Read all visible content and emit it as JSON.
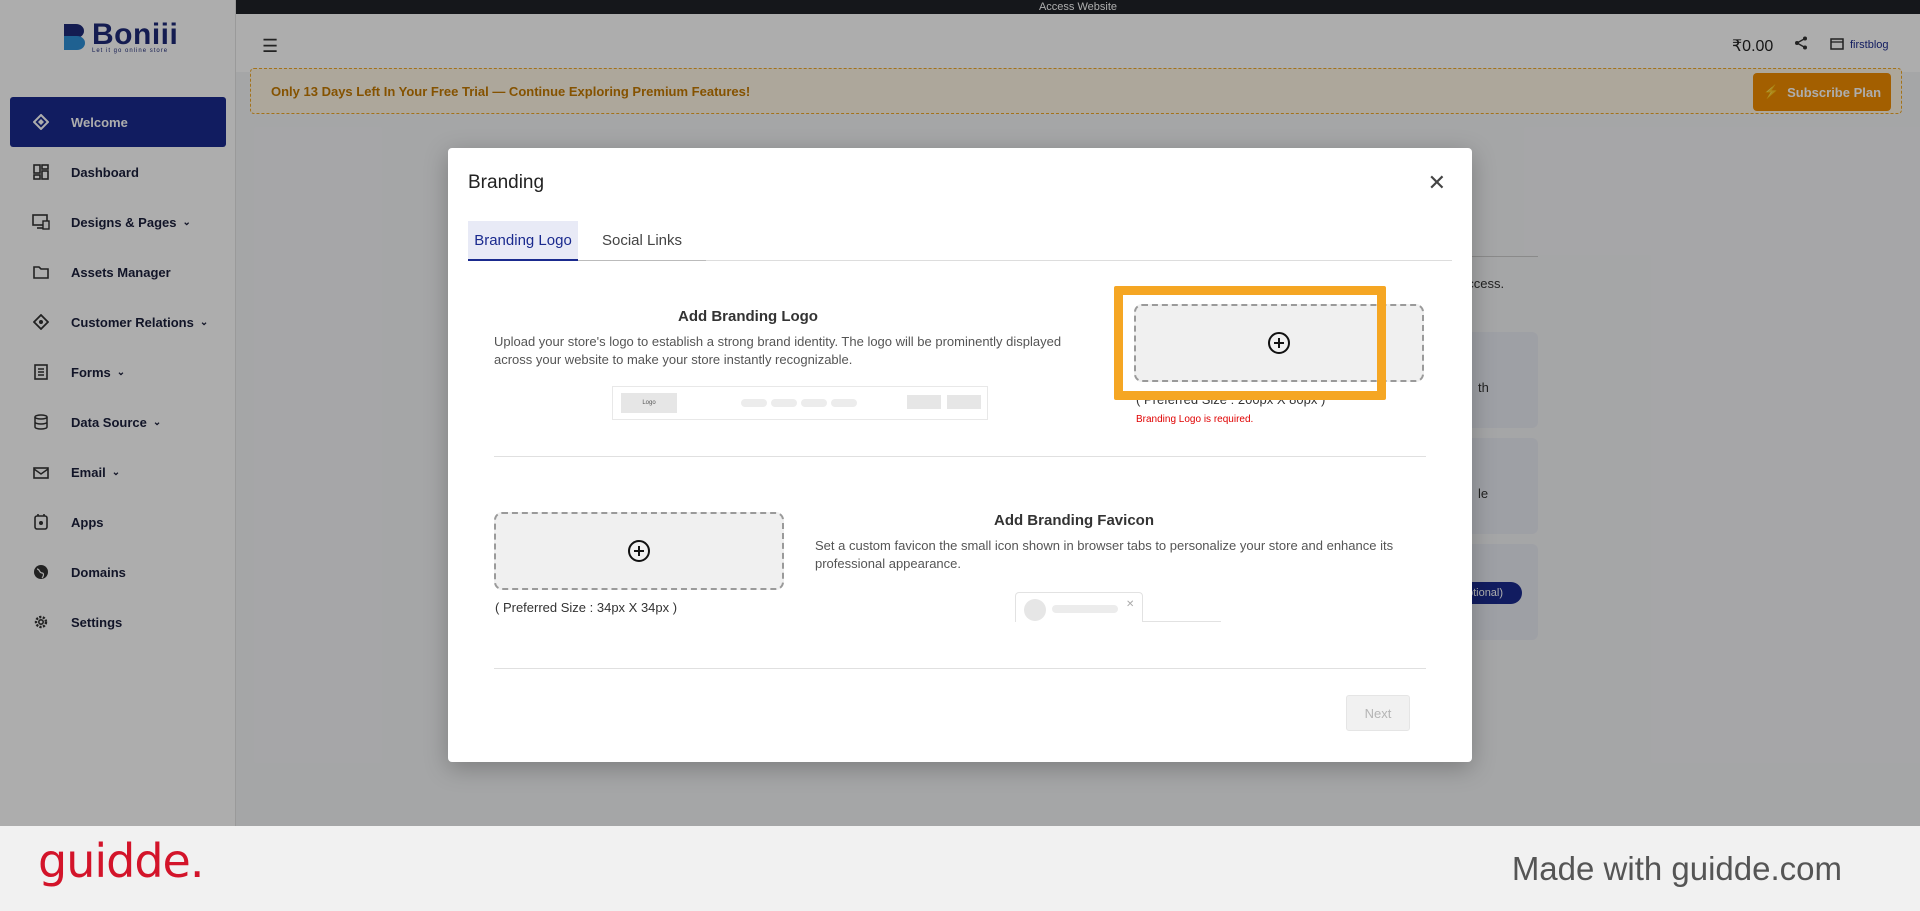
{
  "app": {
    "logo_text": "Boniii",
    "logo_tag": "Let it go online store",
    "access_website": "Access Website",
    "balance": "₹0.00",
    "store_name": "firstblog"
  },
  "sidebar": {
    "items": [
      {
        "label": "Welcome",
        "icon": "diamond-icon",
        "chevron": false
      },
      {
        "label": "Dashboard",
        "icon": "grid-icon",
        "chevron": false
      },
      {
        "label": "Designs & Pages",
        "icon": "design-icon",
        "chevron": true
      },
      {
        "label": "Assets Manager",
        "icon": "folder-icon",
        "chevron": false
      },
      {
        "label": "Customer Relations",
        "icon": "tag-icon",
        "chevron": true
      },
      {
        "label": "Forms",
        "icon": "form-icon",
        "chevron": true
      },
      {
        "label": "Data Source",
        "icon": "database-icon",
        "chevron": true
      },
      {
        "label": "Email",
        "icon": "email-icon",
        "chevron": true
      },
      {
        "label": "Apps",
        "icon": "apps-icon",
        "chevron": false
      },
      {
        "label": "Domains",
        "icon": "globe-icon",
        "chevron": false
      },
      {
        "label": "Settings",
        "icon": "gear-icon",
        "chevron": false
      }
    ]
  },
  "trial": {
    "message": "Only 13 Days Left In Your Free Trial — Continue Exploring Premium Features!",
    "subscribe_label": "Subscribe Plan"
  },
  "background": {
    "text1": "uccess.",
    "text2": "th",
    "text3": "le",
    "pill": "ptional)"
  },
  "modal": {
    "title": "Branding",
    "tabs": [
      "Branding Logo",
      "Social Links"
    ],
    "logo_section": {
      "title": "Add Branding Logo",
      "description": "Upload your store's logo to establish a strong brand identity. The logo will be prominently displayed across your website to make your store instantly recognizable.",
      "preview_label": "Logo",
      "preferred_size": "( Preferred Size : 200px X 80px )",
      "error": "Branding Logo is required."
    },
    "favicon_section": {
      "title": "Add Branding Favicon",
      "description": "Set a custom favicon the small icon shown in browser tabs to personalize your store and enhance its professional appearance.",
      "preferred_size": "( Preferred Size : 34px X 34px )"
    },
    "next_label": "Next"
  },
  "footer": {
    "brand": "guidde.",
    "made_with": "Made with guidde.com"
  },
  "colors": {
    "primary": "#1a2a8e",
    "highlight": "#f5a623",
    "warning": "#f08c00",
    "error": "#e00000",
    "guidde_red": "#d3142a"
  }
}
